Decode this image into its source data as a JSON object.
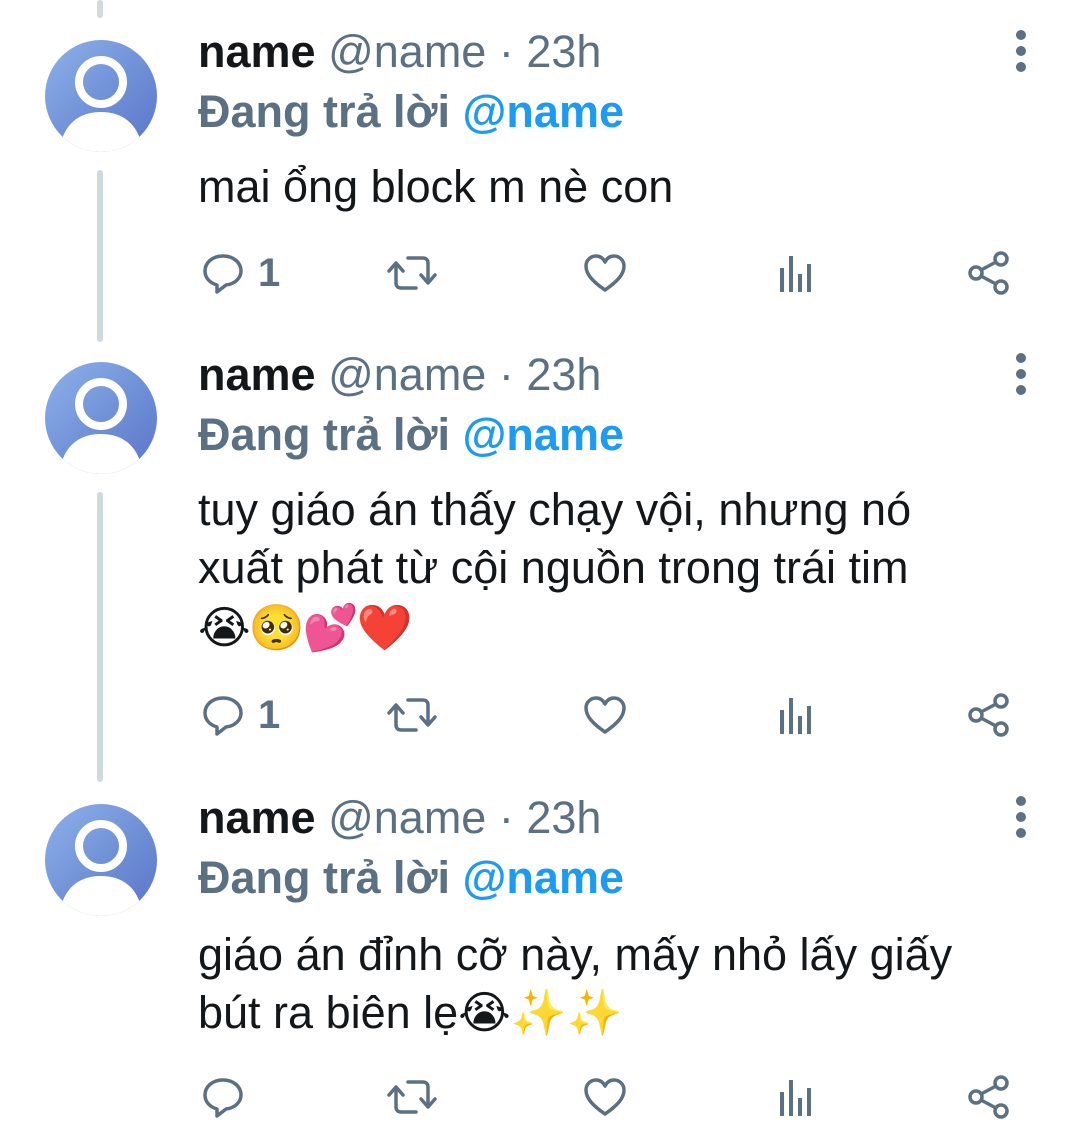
{
  "tweets": [
    {
      "name": "name",
      "handle": "@name",
      "separator": "·",
      "time": "23h",
      "replying_prefix": "Đang trả lời",
      "replying_to": "@name",
      "text_lines": [
        "mai ổng block m nè con"
      ],
      "emoji_line": "",
      "reply_count": "1"
    },
    {
      "name": "name",
      "handle": "@name",
      "separator": "·",
      "time": "23h",
      "replying_prefix": "Đang trả lời",
      "replying_to": "@name",
      "text_lines": [
        "tuy giáo án thấy chạy vội, nhưng nó",
        "xuất phát từ cội nguồn trong trái tim"
      ],
      "emoji_line": "😭🥺💕❤️",
      "reply_count": "1"
    },
    {
      "name": "name",
      "handle": "@name",
      "separator": "·",
      "time": "23h",
      "replying_prefix": "Đang trả lời",
      "replying_to": "@name",
      "text_lines": [
        "giáo án đỉnh cỡ này, mấy nhỏ lấy giấy",
        "bút ra biên lẹ😭✨✨"
      ],
      "emoji_line": "",
      "reply_count": ""
    }
  ],
  "icons": {
    "avatar": "default-avatar-icon",
    "more": "more-vertical-icon",
    "reply": "reply-bubble-icon",
    "retweet": "retweet-icon",
    "like": "heart-icon",
    "analytics": "analytics-bars-icon",
    "share": "share-icon"
  },
  "colors": {
    "text": "#14171a",
    "secondary": "#5b7083",
    "mention": "#1d9bf0",
    "thread_line": "#cfd9de"
  }
}
